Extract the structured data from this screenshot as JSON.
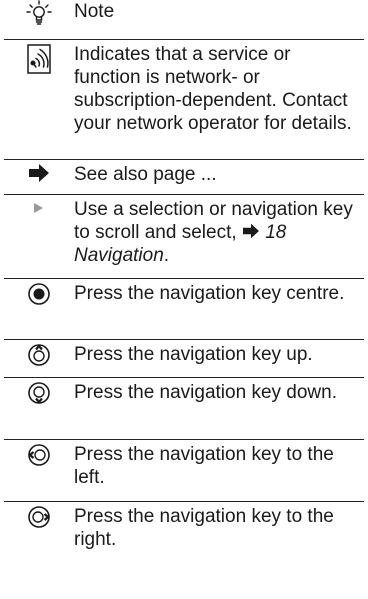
{
  "rows": [
    {
      "icon": "lightbulb-tip-icon",
      "text": "Note"
    },
    {
      "icon": "network-service-icon",
      "text": "Indicates that a service or function is network- or subscription-dependent. Contact your network operator for details."
    },
    {
      "icon": "arrow-right-icon",
      "text": "See also page ..."
    },
    {
      "icon": "small-triangle-icon",
      "text": "Use a selection or navigation key to scroll and select,",
      "ref_page": "18",
      "ref_title": "Navigation",
      "ref_end": "."
    },
    {
      "icon": "nav-key-centre-icon",
      "text": "Press the navigation key centre."
    },
    {
      "icon": "nav-key-up-icon",
      "text": "Press the navigation key up."
    },
    {
      "icon": "nav-key-down-icon",
      "text": "Press the navigation key down."
    },
    {
      "icon": "nav-key-left-icon",
      "text": "Press the navigation key to the left."
    },
    {
      "icon": "nav-key-right-icon",
      "text": "Press the navigation key to the right."
    }
  ],
  "colors": {
    "text": "#1a1a1a",
    "rule": "#222222",
    "triangle": "#9a9a9a"
  }
}
